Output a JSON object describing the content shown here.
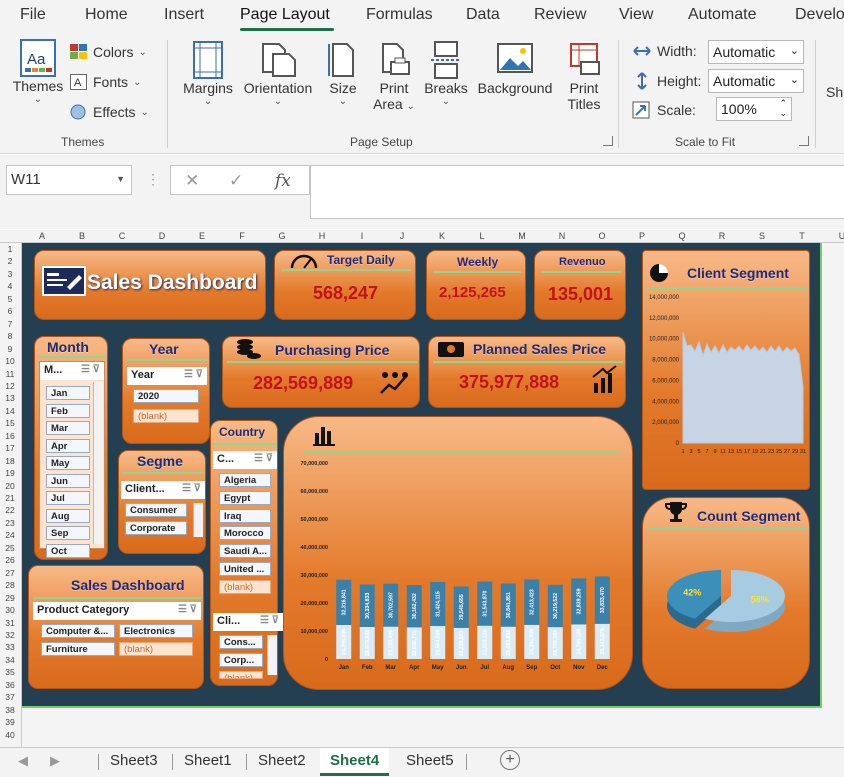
{
  "menu": {
    "items": [
      "File",
      "Home",
      "Insert",
      "Page Layout",
      "Formulas",
      "Data",
      "Review",
      "View",
      "Automate",
      "Develo"
    ],
    "active": "Page Layout"
  },
  "ribbon": {
    "themes": {
      "themes_label": "Themes",
      "colors": "Colors",
      "fonts": "Fonts",
      "effects": "Effects",
      "group": "Themes"
    },
    "page_setup": {
      "margins": "Margins",
      "orientation": "Orientation",
      "size": "Size",
      "print_area_1": "Print",
      "print_area_2": "Area",
      "breaks": "Breaks",
      "background": "Background",
      "print_titles_1": "Print",
      "print_titles_2": "Titles",
      "group": "Page Setup"
    },
    "scale_to_fit": {
      "width_label": "Width:",
      "width_value": "Automatic",
      "height_label": "Height:",
      "height_value": "Automatic",
      "scale_label": "Scale:",
      "scale_value": "100%",
      "group": "Scale to Fit"
    },
    "sheet_options_clip": "Sh"
  },
  "formula_bar": {
    "name_box": "W11",
    "fx": "fx",
    "cancel": "✕",
    "enter": "✓",
    "value": ""
  },
  "columns": [
    "A",
    "B",
    "C",
    "D",
    "E",
    "F",
    "G",
    "H",
    "I",
    "J",
    "K",
    "L",
    "M",
    "N",
    "O",
    "P",
    "Q",
    "R",
    "S",
    "T",
    "U"
  ],
  "rows": [
    "1",
    "2",
    "3",
    "4",
    "5",
    "6",
    "7",
    "8",
    "9",
    "10",
    "11",
    "12",
    "13",
    "14",
    "15",
    "16",
    "17",
    "18",
    "19",
    "20",
    "21",
    "22",
    "23",
    "24",
    "25",
    "26",
    "27",
    "28",
    "29",
    "30",
    "31",
    "32",
    "33",
    "34",
    "35",
    "36",
    "37",
    "38",
    "39",
    "40"
  ],
  "dashboard": {
    "title": "Sales Dashboard",
    "target_daily": {
      "label": "Target Daily",
      "value": "568,247"
    },
    "weekly": {
      "label": "Weekly",
      "value": "2,125,265"
    },
    "revenue": {
      "label": "Revenuo",
      "value": "135,001"
    },
    "purchasing": {
      "label": "Purchasing Price",
      "value": "282,569,889"
    },
    "planned": {
      "label": "Planned Sales Price",
      "value": "375,977,888"
    },
    "client_segment": {
      "label": "Client Segment"
    },
    "count_segment": {
      "label": "Count Segment"
    },
    "sales_box_title": "Sales Dashboard",
    "slicers": {
      "month": {
        "title": "Month",
        "head": "M...",
        "items": [
          "Jan",
          "Feb",
          "Mar",
          "Apr",
          "May",
          "Jun",
          "Jul",
          "Aug",
          "Sep",
          "Oct"
        ]
      },
      "year": {
        "title": "Year",
        "head": "Year",
        "items": [
          "2020"
        ],
        "blank": "(blank)"
      },
      "segment": {
        "title": "Segme",
        "head": "Client...",
        "items": [
          "Consumer",
          "Corporate"
        ]
      },
      "country": {
        "title": "Country",
        "head": "C...",
        "items": [
          "Algeria",
          "Egypt",
          "Iraq",
          "Morocco",
          "Saudi A...",
          "United ..."
        ],
        "blank": "(blank)"
      },
      "client": {
        "head": "Cli...",
        "items": [
          "Cons...",
          "Corp..."
        ],
        "blank": "(blank)"
      },
      "product": {
        "head": "Product Category",
        "items": [
          "Computer &...",
          "Electronics",
          "Furniture"
        ],
        "blank": "(blank)"
      }
    }
  },
  "tabs": {
    "items": [
      "Sheet3",
      "Sheet1",
      "Sheet2",
      "Sheet4",
      "Sheet5"
    ],
    "active": "Sheet4",
    "add": "+"
  },
  "chart_data": [
    {
      "type": "bar",
      "categories": [
        "Jan",
        "Feb",
        "Mar",
        "Apr",
        "May",
        "Jun",
        "Jul",
        "Aug",
        "Sep",
        "Oct",
        "Nov",
        "Dec"
      ],
      "series": [
        {
          "values": [
            24296236,
            22879532,
            23103495,
            22640715,
            23564599,
            22239571,
            23809120,
            23083992,
            24394939,
            22769183,
            24705128,
            25143379
          ]
        },
        {
          "values": [
            32316841,
            30334833,
            30702597,
            30162432,
            31424115,
            29545655,
            31543870,
            30841851,
            32413423,
            30219522,
            32839259,
            33833470
          ]
        }
      ],
      "ylim": [
        0,
        70000000
      ],
      "yticks": [
        "0",
        "10,000,000",
        "20,000,000",
        "30,000,000",
        "40,000,000",
        "50,000,000",
        "60,000,000",
        "70,000,000"
      ],
      "data_labels_bottom": [
        "24,296,236",
        "22,879,532",
        "23,103,495",
        "22,640,715",
        "23,564,599",
        "22,239,571",
        "23,809,120",
        "23,083,992",
        "24,394,939",
        "22,769,183",
        "24,705,128",
        "25,143,379"
      ],
      "data_labels_top": [
        "32,316,841",
        "30,334,833",
        "30,702,597",
        "30,162,432",
        "31,424,115",
        "29,545,655",
        "31,543,870",
        "30,841,851",
        "32,413,423",
        "30,219,522",
        "32,839,259",
        "33,833,470"
      ],
      "colors": {
        "bottom": "#d9ecf5",
        "top": "#3a80a8"
      }
    },
    {
      "type": "area",
      "x": [
        "1",
        "3",
        "5",
        "7",
        "9",
        "11",
        "13",
        "15",
        "17",
        "19",
        "21",
        "23",
        "25",
        "27",
        "29",
        "31"
      ],
      "values": [
        10600000,
        9300000,
        9400000,
        8800000,
        9700000,
        8400000,
        9500000,
        8700000,
        9300000,
        8600000,
        9400000,
        8700000,
        9200000,
        8900000,
        9300000,
        8800000,
        9400000,
        8900000,
        9300000,
        8800000,
        9200000,
        8700000,
        9300000,
        8800000,
        9300000,
        8700000,
        9200000,
        8800000,
        9100000,
        8500000,
        5400000
      ],
      "ylim": [
        0,
        14000000
      ],
      "yticks": [
        "0",
        "2,000,000",
        "4,000,000",
        "6,000,000",
        "8,000,000",
        "10,000,000",
        "12,000,000",
        "14,000,000"
      ],
      "colors": {
        "fill": "#c6d4e6"
      }
    },
    {
      "type": "pie",
      "labels": [
        "42%",
        "58%"
      ],
      "values": [
        42,
        58
      ],
      "colors": [
        "#3c8fb8",
        "#a7cbe0"
      ]
    }
  ]
}
